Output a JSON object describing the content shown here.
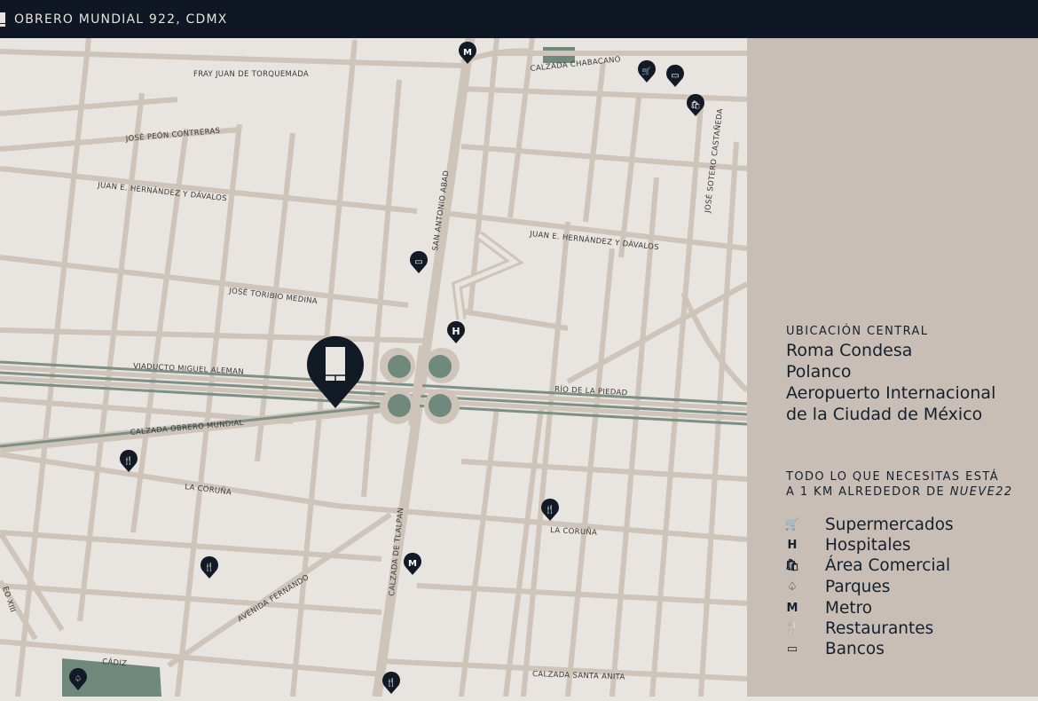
{
  "header": {
    "title": "OBRERO MUNDIAL 922, CDMX",
    "icon": "building-icon"
  },
  "colors": {
    "header_bg": "#0f1724",
    "map_bg": "#e8e4df",
    "roads": "#cec4b9",
    "highway": "#7e8f86",
    "park": "#6f8a7c",
    "panel_bg": "#c8beb5",
    "pin": "#121a26"
  },
  "map": {
    "streets": {
      "fray_juan": "FRAY JUAN DE TORQUEMADA",
      "jose_peon": "JOSÉ PEÓN CONTRERAS",
      "juan_hernandez_left": "JUAN E. HERNÁNDEZ Y DÁVALOS",
      "juan_hernandez_right": "JUAN E. HERNÁNDEZ Y DÁVALOS",
      "jose_toribio": "JOSÉ TORIBIO MEDINA",
      "viaducto": "VIADUCTO MIGUEL ALEMAN",
      "rio_piedad": "RÍO DE LA PIEDAD",
      "calzada_obrero": "CALZADA OBRERO MUNDIAL",
      "la_coruna_left": "LA CORUÑA",
      "la_coruna_right": "LA CORUÑA",
      "avenida_fernando": "AVENIDA FERNANDO",
      "cadiz": "CÁDIZ",
      "calzada_santa_anita": "CALZADA SANTA ANITA",
      "calzada_tlalpan": "CALZADA DE TLALPAN",
      "san_antonio": "SAN ANTONIO ABAD",
      "calzada_chabacano": "CALZADA CHABACANO",
      "jose_sotero": "JOSÉ SOTERO CASTAÑEDA",
      "leo_xiii": "EO XIII"
    },
    "pins": [
      {
        "type": "metro",
        "glyph": "M"
      },
      {
        "type": "supermercado",
        "glyph": "🛒"
      },
      {
        "type": "banco",
        "glyph": "▭"
      },
      {
        "type": "comercial",
        "glyph": "🛍"
      },
      {
        "type": "banco",
        "glyph": "▭"
      },
      {
        "type": "hospital",
        "glyph": "H"
      },
      {
        "type": "restaurante",
        "glyph": "🍴"
      },
      {
        "type": "restaurante",
        "glyph": "🍴"
      },
      {
        "type": "metro",
        "glyph": "M"
      },
      {
        "type": "restaurante",
        "glyph": "🍴"
      },
      {
        "type": "parque",
        "glyph": "♤"
      },
      {
        "type": "restaurante",
        "glyph": "🍴"
      }
    ]
  },
  "panel": {
    "central_title": "UBICACIÓN CENTRAL",
    "places": [
      "Roma Condesa",
      "Polanco",
      "Aeropuerto Internacional",
      "de la Ciudad de México"
    ],
    "needs_line1": "TODO LO QUE NECESITAS ESTÁ",
    "needs_line2_prefix": "A 1 KM ALREDEDOR DE ",
    "needs_line2_emph": "NUEVE22",
    "legend": [
      {
        "icon": "cart-icon",
        "glyph": "🛒",
        "label": "Supermercados"
      },
      {
        "icon": "hospital-icon",
        "glyph": "H",
        "label": "Hospitales"
      },
      {
        "icon": "shopping-bag-icon",
        "glyph": "🛍",
        "label": "Área Comercial"
      },
      {
        "icon": "tree-icon",
        "glyph": "♤",
        "label": "Parques"
      },
      {
        "icon": "metro-icon",
        "glyph": "M",
        "label": "Metro"
      },
      {
        "icon": "fork-knife-icon",
        "glyph": "🍴",
        "label": "Restaurantes"
      },
      {
        "icon": "bank-card-icon",
        "glyph": "▭",
        "label": "Bancos"
      }
    ]
  }
}
